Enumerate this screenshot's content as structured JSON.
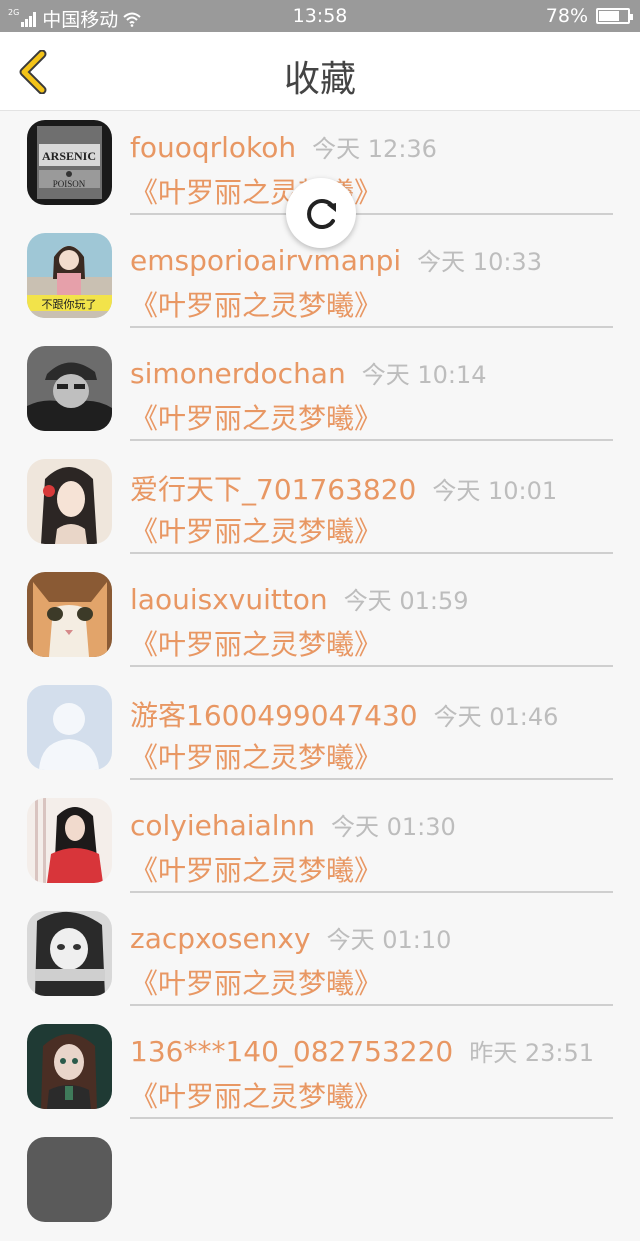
{
  "status_bar": {
    "network_tag": "2G",
    "carrier": "中国移动",
    "time": "13:58",
    "battery": "78%",
    "battery_level": 0.78
  },
  "header": {
    "title": "收藏"
  },
  "items": [
    {
      "name": "fouoqrlokoh",
      "time": "今天 12:36",
      "work": "《叶罗丽之灵梦曦》"
    },
    {
      "name": "emsporioairvmanpi",
      "time": "今天 10:33",
      "work": "《叶罗丽之灵梦曦》"
    },
    {
      "name": "simonerdochan",
      "time": "今天 10:14",
      "work": "《叶罗丽之灵梦曦》"
    },
    {
      "name": "爱行天下_701763820",
      "time": "今天 10:01",
      "work": "《叶罗丽之灵梦曦》"
    },
    {
      "name": "laouisxvuitton",
      "time": "今天 01:59",
      "work": "《叶罗丽之灵梦曦》"
    },
    {
      "name": "游客1600499047430",
      "time": "今天 01:46",
      "work": "《叶罗丽之灵梦曦》"
    },
    {
      "name": "colyiehaialnn",
      "time": "今天 01:30",
      "work": "《叶罗丽之灵梦曦》"
    },
    {
      "name": "zacpxosenxy",
      "time": "今天 01:10",
      "work": "《叶罗丽之灵梦曦》"
    },
    {
      "name": "136***140_082753220",
      "time": "昨天 23:51",
      "work": "《叶罗丽之灵梦曦》"
    }
  ],
  "avatar_texts": {
    "arsenic": "ARSENIC",
    "poison": "POISON",
    "caption": "不跟你玩了"
  },
  "colors": {
    "accent": "#e89763",
    "time_gray": "#bdbdbd",
    "back_arrow": "#f3c318",
    "status_bar": "#9a9a9a"
  },
  "icons": {
    "back": "chevron-left-icon",
    "refresh": "refresh-icon",
    "wifi": "wifi-icon",
    "battery": "battery-icon",
    "signal": "signal-icon"
  }
}
